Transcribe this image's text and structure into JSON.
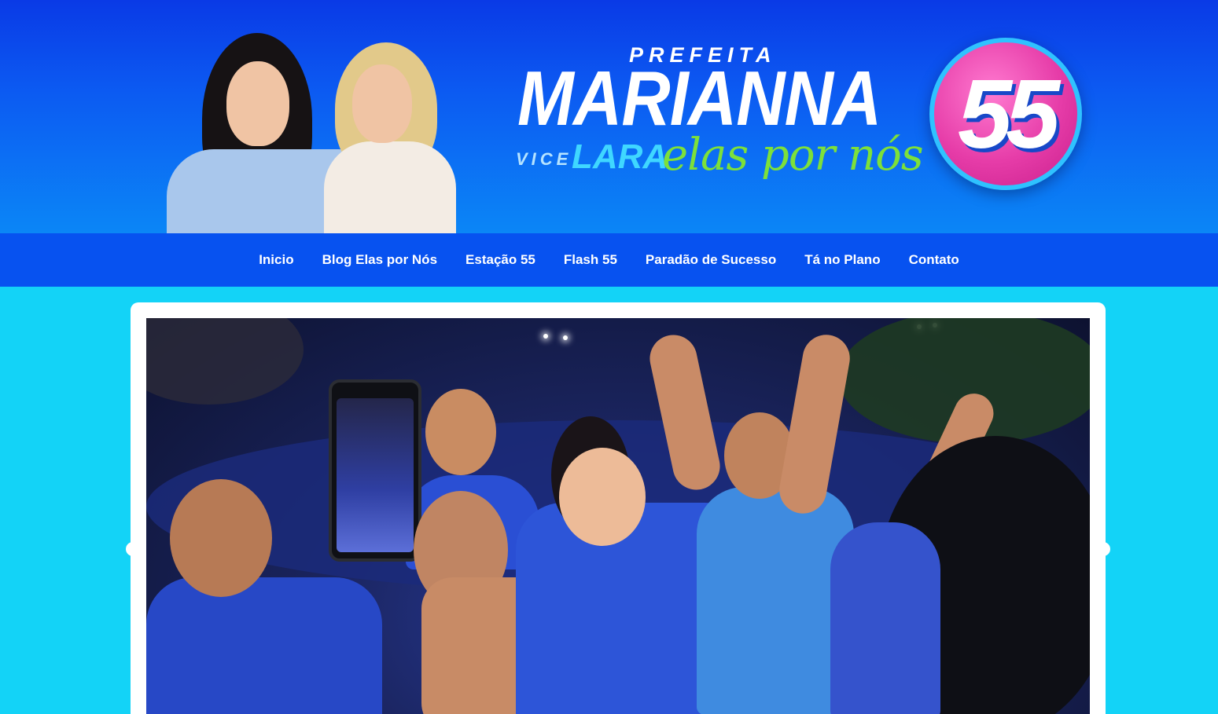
{
  "banner": {
    "title_line1": "PREFEITA",
    "title_line2": "MARIANNA",
    "vice_label": "VICE",
    "vice_name": "LARA",
    "slogan": "elas por nós",
    "number": "55"
  },
  "nav": {
    "items": [
      {
        "label": "Inicio"
      },
      {
        "label": "Blog Elas por Nós"
      },
      {
        "label": "Estação 55"
      },
      {
        "label": "Flash 55"
      },
      {
        "label": "Paradão de Sucesso"
      },
      {
        "label": "Tá no Plano"
      },
      {
        "label": "Contato"
      }
    ]
  },
  "colors": {
    "background": "#13d3f7",
    "nav": "#0752f0",
    "banner": "#0a3ae6",
    "badge": "#e63ca8",
    "slogan": "#7de03a"
  },
  "icons": {
    "slider_prev": "chevron-left-icon",
    "slider_next": "chevron-right-icon"
  }
}
